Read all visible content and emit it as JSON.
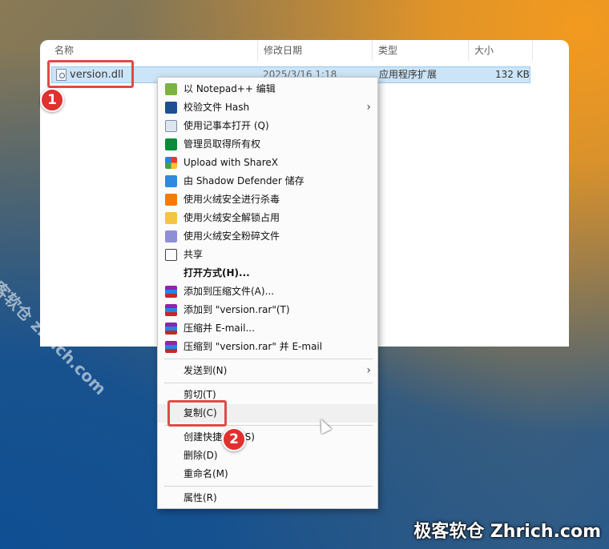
{
  "explorer": {
    "columns": {
      "name": "名称",
      "modified": "修改日期",
      "type": "类型",
      "size": "大小"
    },
    "file": {
      "name": "version.dll",
      "modified": "2025/3/16 1:18",
      "type": "应用程序扩展",
      "size": "132 KB"
    }
  },
  "badges": {
    "one": "1",
    "two": "2"
  },
  "menu": {
    "items": [
      {
        "label": "以 Notepad++ 编辑",
        "icon": "notepadpp-icon"
      },
      {
        "label": "校验文件 Hash",
        "icon": "powershell-icon",
        "arrow": "›"
      },
      {
        "label": "使用记事本打开 (Q)",
        "icon": "notepad-icon"
      },
      {
        "label": "管理员取得所有权",
        "icon": "shield-check-icon"
      },
      {
        "label": "Upload with ShareX",
        "icon": "sharex-icon"
      },
      {
        "label": "由 Shadow Defender 储存",
        "icon": "shadow-defender-icon"
      },
      {
        "label": "使用火绒安全进行杀毒",
        "icon": "huorong-icon"
      },
      {
        "label": "使用火绒安全解锁占用",
        "icon": "folder-unlock-icon"
      },
      {
        "label": "使用火绒安全粉碎文件",
        "icon": "shredder-icon"
      },
      {
        "label": "共享",
        "icon": "share-icon"
      },
      {
        "label": "打开方式(H)..."
      },
      {
        "label": "添加到压缩文件(A)...",
        "icon": "winrar-icon"
      },
      {
        "label": "添加到 \"version.rar\"(T)",
        "icon": "winrar-icon"
      },
      {
        "label": "压缩并 E-mail...",
        "icon": "winrar-icon"
      },
      {
        "label": "压缩到 \"version.rar\" 并 E-mail",
        "icon": "winrar-icon"
      },
      {
        "label": "发送到(N)",
        "arrow": "›"
      },
      {
        "label": "剪切(T)"
      },
      {
        "label": "复制(C)"
      },
      {
        "label": "创建快捷方式(S)"
      },
      {
        "label": "删除(D)"
      },
      {
        "label": "重命名(M)"
      },
      {
        "label": "属性(R)"
      }
    ]
  },
  "watermarks": {
    "diagonal": "极客软仓 zhrich.com",
    "corner": "极客软仓 Zhrich.com"
  },
  "colors": {
    "highlight": "#e04a4a",
    "badge": "#e0312f",
    "selection": "#cce4f7"
  }
}
